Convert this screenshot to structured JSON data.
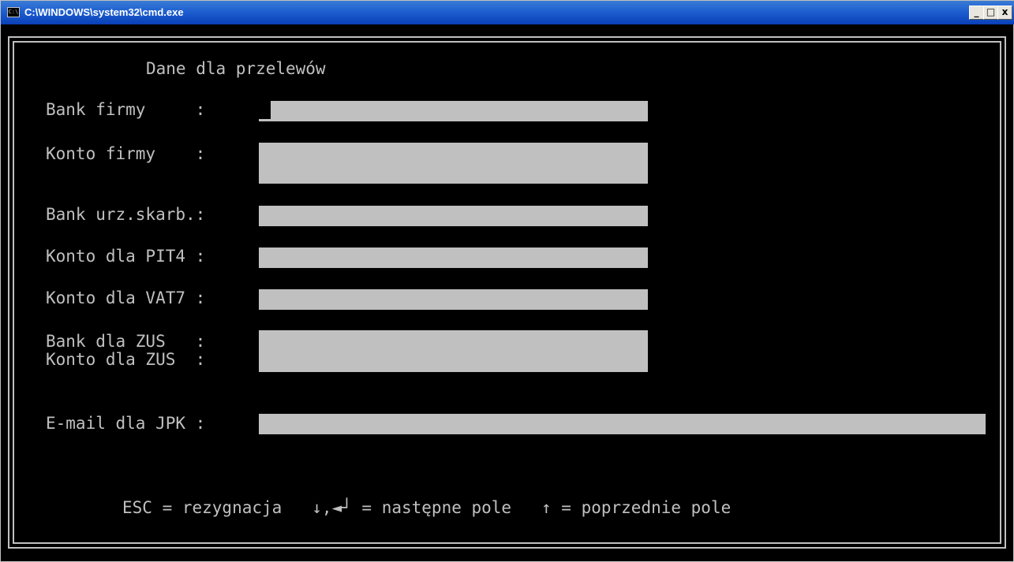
{
  "window": {
    "title": "C:\\WINDOWS\\system32\\cmd.exe",
    "icon": "cmd-console-icon",
    "icon_text": "C:\\",
    "buttons": {
      "minimize": "_",
      "maximize": "□",
      "close": "x"
    }
  },
  "form": {
    "heading": "Dane dla przelewów",
    "fields": {
      "bank_firmy": {
        "label": "Bank firmy     :",
        "value": ""
      },
      "konto_firmy": {
        "label": "Konto firmy    :",
        "value": ""
      },
      "bank_urz": {
        "label": "Bank urz.skarb.:",
        "value": ""
      },
      "konto_pit4": {
        "label": "Konto dla PIT4 :",
        "value": ""
      },
      "konto_vat7": {
        "label": "Konto dla VAT7 :",
        "value": ""
      },
      "bank_zus": {
        "label": "Bank dla ZUS   :",
        "value": ""
      },
      "konto_zus": {
        "label": "Konto dla ZUS  :",
        "value": ""
      },
      "email_jpk": {
        "label": "E-mail dla JPK :",
        "value": ""
      }
    },
    "help": "ESC = rezygnacja   ↓,◄┘ = następne pole   ↑ = poprzednie pole"
  },
  "colors": {
    "field_bg": "#c0c0c0",
    "console_bg": "#000000",
    "console_fg": "#c0c0c0",
    "titlebar": "#0a3fb8"
  }
}
